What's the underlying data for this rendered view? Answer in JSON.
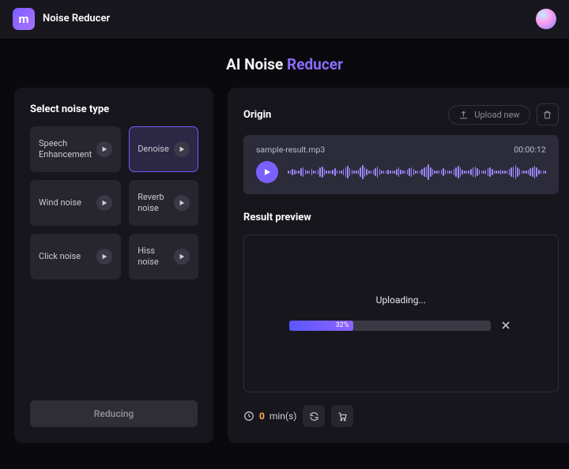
{
  "header": {
    "app_name": "Noise Reducer",
    "logo_glyph": "m"
  },
  "title_parts": {
    "w1": "AI",
    "w2": "Noise",
    "w3": "Reducer"
  },
  "sidebar": {
    "heading": "Select noise type",
    "types": [
      {
        "label": "Speech Enhancement",
        "selected": false
      },
      {
        "label": "Denoise",
        "selected": true
      },
      {
        "label": "Wind noise",
        "selected": false
      },
      {
        "label": "Reverb noise",
        "selected": false
      },
      {
        "label": "Click noise",
        "selected": false
      },
      {
        "label": "Hiss noise",
        "selected": false
      }
    ],
    "reduce_button_label": "Reducing"
  },
  "origin": {
    "heading": "Origin",
    "upload_new_label": "Upload new",
    "file_name": "sample-result.mp3",
    "duration": "00:00:12"
  },
  "result": {
    "heading": "Result preview",
    "status_text": "Uploading...",
    "progress_pct": 32,
    "progress_pct_label": "32%"
  },
  "footer": {
    "minutes_value": "0",
    "minutes_unit": "min(s)"
  },
  "colors": {
    "accent": "#7a61ff",
    "accent_alt": "#8f63ff",
    "warn": "#ffb14d"
  }
}
